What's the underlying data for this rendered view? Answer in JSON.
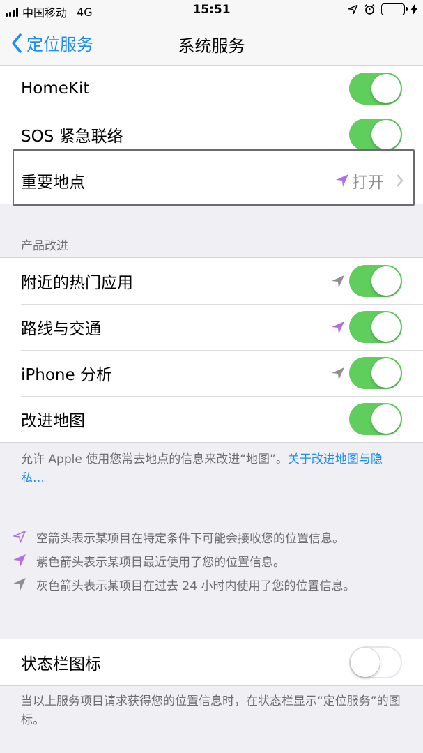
{
  "status_bar": {
    "carrier": "中国移动",
    "network": "4G",
    "time": "15:51",
    "battery_color": "#4cd964"
  },
  "nav": {
    "back_label": "定位服务",
    "title": "系统服务",
    "accent_color": "#1a8cff"
  },
  "group1": {
    "rows": [
      {
        "label": "HomeKit",
        "toggle": "on"
      },
      {
        "label": "SOS 紧急联络",
        "toggle": "on"
      },
      {
        "label": "重要地点",
        "value": "打开",
        "indicator": "purple-arrow-icon"
      }
    ]
  },
  "section_product": {
    "header": "产品改进",
    "rows": [
      {
        "label": "附近的热门应用",
        "toggle": "on",
        "indicator": "gray-arrow-icon"
      },
      {
        "label": "路线与交通",
        "toggle": "on",
        "indicator": "purple-arrow-icon"
      },
      {
        "label": "iPhone 分析",
        "toggle": "on",
        "indicator": "gray-arrow-icon"
      },
      {
        "label": "改进地图",
        "toggle": "on"
      }
    ],
    "footer_text": "允许 Apple 使用您常去地点的信息来改进“地图”。",
    "footer_link": "关于改进地图与隐私…"
  },
  "legend": [
    {
      "icon": "hollow-arrow-icon",
      "text": "空箭头表示某项目在特定条件下可能会接收您的位置信息。"
    },
    {
      "icon": "purple-arrow-icon",
      "text": "紫色箭头表示某项目最近使用了您的位置信息。"
    },
    {
      "icon": "gray-arrow-icon",
      "text": "灰色箭头表示某项目在过去 24 小时内使用了您的位置信息。"
    }
  ],
  "status_icon_group": {
    "label": "状态栏图标",
    "toggle": "off",
    "footer_text": "当以上服务项目请求获得您的位置信息时，在状态栏显示“定位服务”的图标。"
  },
  "colors": {
    "toggle_on": "#5fce5d",
    "purple_arrow": "#b06ee8",
    "gray_arrow": "#8e8e93",
    "link": "#1a8cff"
  }
}
